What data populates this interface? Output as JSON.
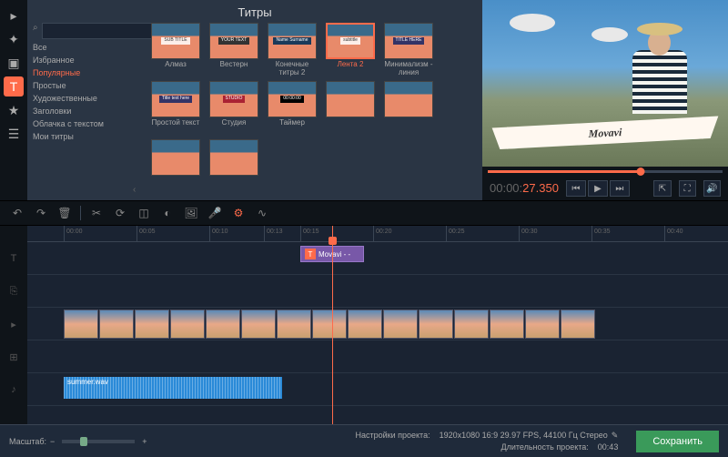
{
  "panel_title": "Титры",
  "categories": [
    "Все",
    "Избранное",
    "Популярные",
    "Простые",
    "Художественные",
    "Заголовки",
    "Облачка с текстом",
    "Мои титры"
  ],
  "active_category": 2,
  "tiles": [
    {
      "label": "Алмаз",
      "overlay": "SUB TITLE"
    },
    {
      "label": "Вестерн",
      "overlay": "YOUR TEXT"
    },
    {
      "label": "Конечные титры 2",
      "overlay": "Name Surname"
    },
    {
      "label": "Лента 2",
      "overlay": "subtitle",
      "selected": true
    },
    {
      "label": "Минимализм - линия",
      "overlay": "TITLE HERE"
    },
    {
      "label": "Простой текст",
      "overlay": "Title text here"
    },
    {
      "label": "Студия",
      "overlay": "STUDIO"
    },
    {
      "label": "Таймер",
      "overlay": "00:00:00"
    }
  ],
  "preview_brand": "Movavi",
  "timecode_prefix": "00:00:",
  "timecode_seconds": "27.350",
  "timeline_ticks": [
    "00:00",
    "00:05",
    "00:10",
    "00:13",
    "00:15",
    "00:20",
    "00:25",
    "00:30",
    "00:35",
    "00:40"
  ],
  "title_clip_label": "Movavi - -",
  "audio_clip_label": "summer.wav",
  "footer": {
    "zoom_label": "Масштаб:",
    "settings_label": "Настройки проекта:",
    "settings_value": "1920x1080 16:9 29.97 FPS, 44100 Гц Стерео",
    "duration_label": "Длительность проекта:",
    "duration_value": "00:43",
    "save_label": "Сохранить"
  }
}
